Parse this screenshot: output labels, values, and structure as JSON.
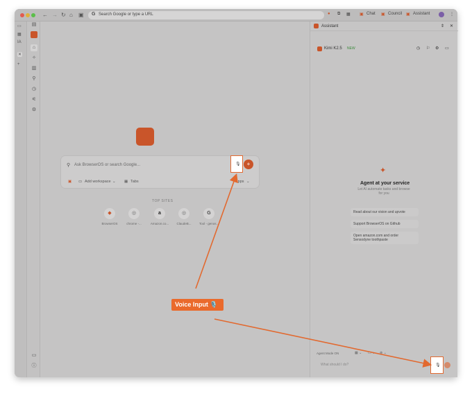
{
  "toolbar": {
    "omnibox_placeholder": "Search Google or type a URL",
    "chat_label": "Chat",
    "council_label": "Council",
    "assistant_label": "Assistant"
  },
  "newtab": {
    "search_placeholder": "Ask BrowserOS or search Google...",
    "add_workspace_label": "Add workspace",
    "tabs_label": "Tabs",
    "apps_label": "Apps",
    "top_sites_title": "TOP SITES",
    "top_sites": [
      {
        "label": "BrowserOS",
        "icon": "browseros-icon"
      },
      {
        "label": "chrome -...",
        "icon": "chrome-icon"
      },
      {
        "label": "Amazon.co...",
        "icon": "amazon-icon"
      },
      {
        "label": "ClaudeB...",
        "icon": "claude-icon"
      },
      {
        "label": "Tool - genos...",
        "icon": "google-icon"
      }
    ]
  },
  "assistant": {
    "title": "Assistant",
    "model_name": "Kimi K2.5",
    "model_badge": "NEW",
    "heading": "Agent at your service",
    "subheading": "Let AI automate tasks and browse for you",
    "suggestions": [
      "Read about our vision and upvote",
      "Support BrowserOS on Github",
      "Open amazon.com and order Sensodyne toothpaste"
    ],
    "agent_mode_label": "Agent Mode ON",
    "input_placeholder": "What should I do?"
  },
  "annotation": {
    "callout_text": "Voice Input 🎙️"
  },
  "colors": {
    "accent": "#c9552a",
    "callout": "#ea6a2c",
    "arrow": "#e2692f"
  }
}
